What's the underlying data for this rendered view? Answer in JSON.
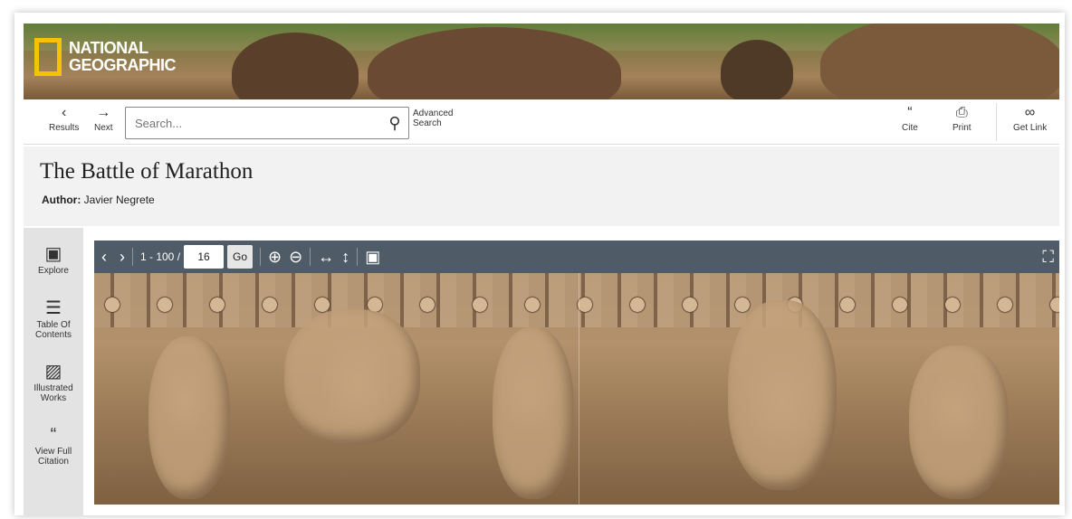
{
  "brand": {
    "line1": "NATIONAL",
    "line2": "GEOGRAPHIC"
  },
  "toolbar": {
    "results_label": "Results",
    "next_label": "Next",
    "search_placeholder": "Search...",
    "advanced_line1": "Advanced",
    "advanced_line2": "Search",
    "cite_label": "Cite",
    "print_label": "Print",
    "getlink_label": "Get Link"
  },
  "document": {
    "title": "The Battle of Marathon",
    "author_label": "Author:",
    "author_name": "Javier Negrete"
  },
  "rail": {
    "items": [
      {
        "label": "Explore"
      },
      {
        "label1": "Table Of",
        "label2": "Contents"
      },
      {
        "label1": "Illustrated",
        "label2": "Works"
      },
      {
        "label1": "View Full",
        "label2": "Citation"
      }
    ]
  },
  "viewer": {
    "range_label": "1 - 100 /",
    "page_value": "16",
    "go_label": "Go"
  },
  "colors": {
    "logo_yellow": "#f5c400",
    "viewer_bar": "#4f5b66",
    "rail_bg": "#e3e3e3"
  },
  "icons": [
    "chevron-left-icon",
    "arrow-right-circle-icon",
    "search-icon",
    "cite-icon",
    "print-icon",
    "link-icon",
    "binoculars-icon",
    "list-icon",
    "image-icon",
    "quote-icon",
    "zoom-in-icon",
    "zoom-out-icon",
    "fit-width-icon",
    "fit-height-icon",
    "fullscreen-icon"
  ]
}
